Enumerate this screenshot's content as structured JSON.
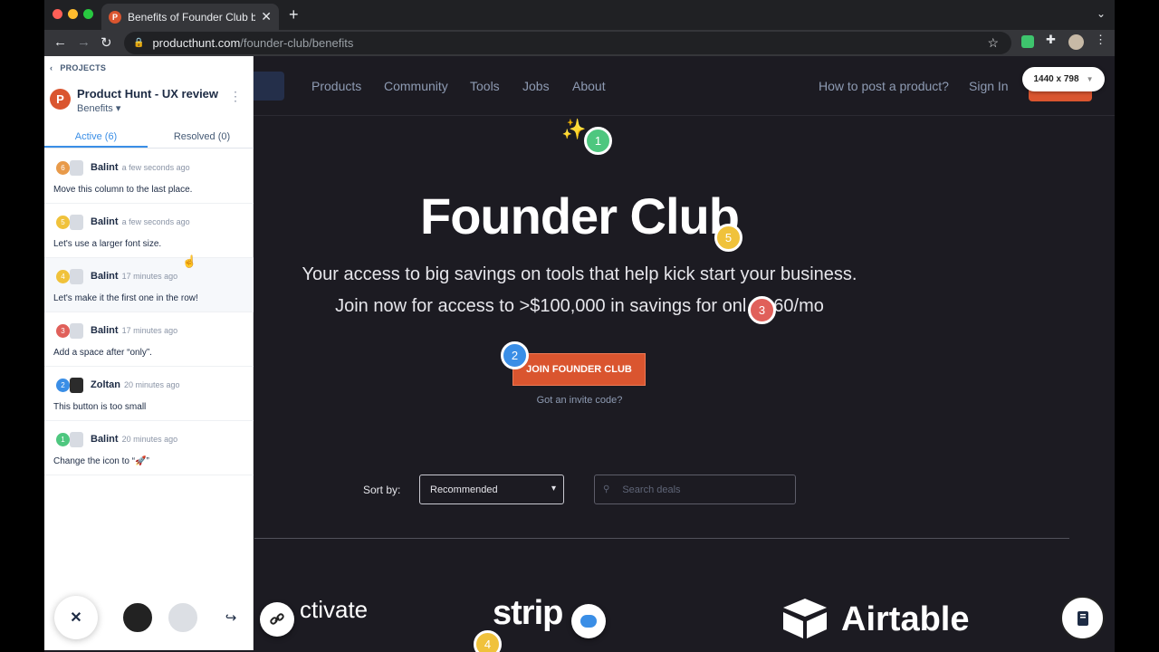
{
  "browser": {
    "tab_title": "Benefits of Founder Club by Pr",
    "url_host": "producthunt.com",
    "url_path": "/founder-club/benefits"
  },
  "site": {
    "nav": [
      "Products",
      "Community",
      "Tools",
      "Jobs",
      "About"
    ],
    "nav_right": [
      "How to post a product?",
      "Sign In"
    ],
    "viewport_size": "1440 x 798",
    "hero_title": "Founder Club",
    "hero_sub1": "Your access to big savings on tools that help kick start your business.",
    "hero_sub2": "Join now for access to >$100,000 in savings for onl",
    "hero_sub2_tail": "60/mo",
    "join_button": "JOIN FOUNDER CLUB",
    "invite_link": "Got an invite code?",
    "sort_label": "Sort by:",
    "sort_value": "Recommended",
    "search_placeholder": "Search deals",
    "logos": [
      "ctivate",
      "strip",
      "Airtable"
    ]
  },
  "markers": [
    {
      "num": "1",
      "color": "#4ec77f"
    },
    {
      "num": "2",
      "color": "#3a8ee6"
    },
    {
      "num": "3",
      "color": "#e0605a"
    },
    {
      "num": "4",
      "color": "#f0c23b"
    },
    {
      "num": "5",
      "color": "#f0c23b"
    }
  ],
  "sidebar": {
    "back_label": "PROJECTS",
    "project_title": "Product Hunt - UX review",
    "page_name": "Benefits",
    "tab_active": "Active (6)",
    "tab_resolved": "Resolved (0)",
    "comments": [
      {
        "num": "6",
        "color": "#e89a4a",
        "author": "Balint",
        "time": "a few seconds ago",
        "text": "Move this column to the last place."
      },
      {
        "num": "5",
        "color": "#f0c23b",
        "author": "Balint",
        "time": "a few seconds ago",
        "text": "Let's use a larger font size."
      },
      {
        "num": "4",
        "color": "#f0c23b",
        "author": "Balint",
        "time": "17 minutes ago",
        "text": "Let's make it the first one in the row!"
      },
      {
        "num": "3",
        "color": "#e0605a",
        "author": "Balint",
        "time": "17 minutes ago",
        "text": "Add a space after “only”."
      },
      {
        "num": "2",
        "color": "#3a8ee6",
        "author": "Zoltan",
        "time": "20 minutes ago",
        "text": "This button is too small"
      },
      {
        "num": "1",
        "color": "#4ec77f",
        "author": "Balint",
        "time": "20 minutes ago",
        "text": "Change the icon to “🚀”"
      }
    ]
  }
}
